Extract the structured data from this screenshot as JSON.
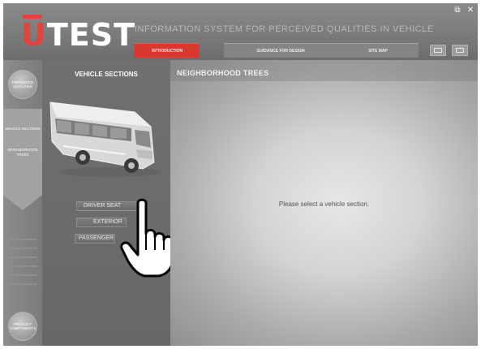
{
  "window": {
    "logo_text": "TEST",
    "logo_letter": "U",
    "title": "INFORMATION SYSTEM FOR PERCEIVED QUALITIES IN VEHICLE DESIGN",
    "controls": {
      "restore": "⧉",
      "close": "✕"
    }
  },
  "nav": {
    "tabs": [
      {
        "label": "INTRODUCTION",
        "active": true
      },
      {
        "label": "GUIDANCE FOR DESIGN",
        "active": false
      },
      {
        "label": "SITE MAP",
        "active": false
      }
    ],
    "icons": [
      "window-icon",
      "settings-icon"
    ]
  },
  "rail": {
    "top_circle": "PERCEIVED QUALITIES",
    "items": [
      "VEHICLE SECTIONS",
      "NEIGHBORHOOD TREES"
    ],
    "bottom_circle": "PRODUCT COMPONENTS"
  },
  "vehicle_sections": {
    "title": "VEHICLE SECTIONS",
    "buttons": [
      "DRIVER SEAT",
      "EXTERIOR",
      "PASSENGER"
    ]
  },
  "main": {
    "title": "NEIGHBORHOOD TREES",
    "message": "Please select a vehicle section."
  },
  "colors": {
    "accent": "#d9382f",
    "logo_red": "#e0443c",
    "panel": "#6e6e6e"
  }
}
